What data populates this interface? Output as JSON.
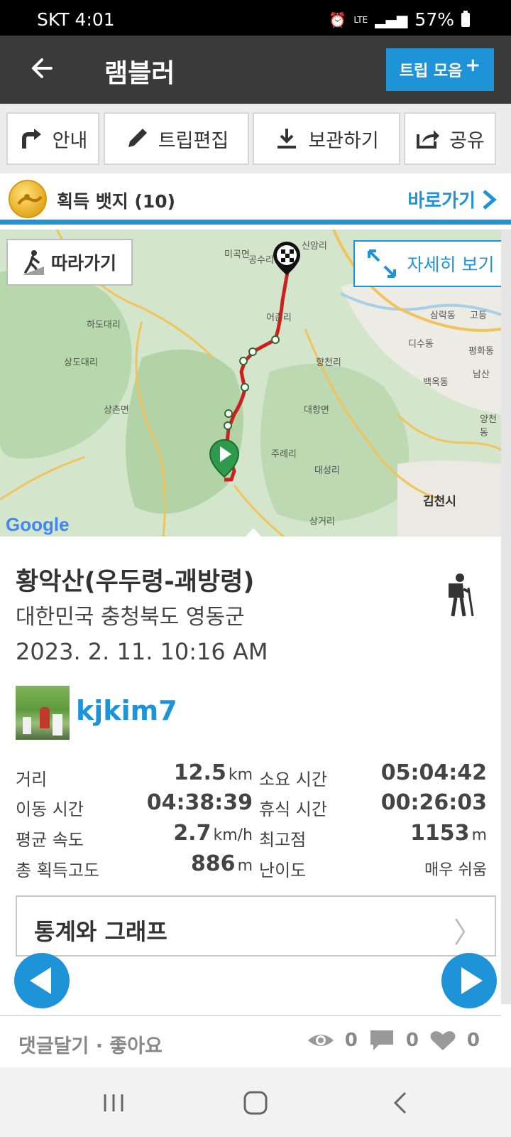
{
  "status_bar": {
    "carrier_time": "SKT  4:01",
    "network": "LTE",
    "battery": "57%",
    "icons": [
      "alarm-icon",
      "lte-icon",
      "signal-icon",
      "battery-icon"
    ]
  },
  "app_bar": {
    "title": "램블러",
    "trip_collection": "트립 모음",
    "trip_collection_plus": "+"
  },
  "actions": {
    "guide": "안내",
    "edit_trip": "트립편집",
    "save": "보관하기",
    "share": "공유"
  },
  "badge": {
    "label": "획득 뱃지 (10)",
    "goto": "바로가기"
  },
  "map": {
    "follow": "따라가기",
    "view_detail": "자세히 보기",
    "attribution": "Google",
    "labels": [
      "미곡면",
      "공수리",
      "신암리",
      "하도대리",
      "어촌리",
      "상도대리",
      "향천리",
      "디수동",
      "상촌면",
      "대항면",
      "백옥동",
      "주례리",
      "대성리",
      "김천시",
      "상거리",
      "삼락동",
      "고등",
      "평화동",
      "남산",
      "양천동"
    ]
  },
  "trip": {
    "title": "황악산(우두령-괘방령)",
    "location": "대한민국 충청북도 영동군",
    "datetime": "2023. 2. 11. 10:16 AM",
    "username": "kjkim7"
  },
  "stats": {
    "distance_label": "거리",
    "distance_value": "12.5",
    "distance_unit": "km",
    "duration_label": "소요 시간",
    "duration_value": "05:04:42",
    "moving_label": "이동 시간",
    "moving_value": "04:38:39",
    "rest_label": "휴식 시간",
    "rest_value": "00:26:03",
    "avg_speed_label": "평균 속도",
    "avg_speed_value": "2.7",
    "avg_speed_unit": "km/h",
    "max_alt_label": "최고점",
    "max_alt_value": "1153",
    "max_alt_unit": "m",
    "gain_label": "총 획득고도",
    "gain_value": "886",
    "gain_unit": "m",
    "difficulty_label": "난이도",
    "difficulty_value": "매우 쉬움"
  },
  "stats_graph_button": "통계와 그래프",
  "footer": {
    "comment_like": "댓글달기 · 좋아요",
    "views": "0",
    "comments": "0",
    "likes": "0"
  },
  "colors": {
    "accent": "#1f93d8",
    "appbar": "#3a3a3a",
    "route": "#cc1f1f"
  }
}
